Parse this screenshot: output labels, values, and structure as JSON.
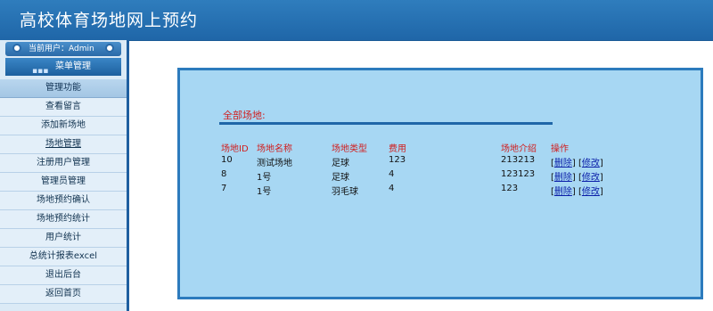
{
  "header": {
    "title": "高校体育场地网上预约"
  },
  "sidebar": {
    "user_label": "当前用户：Admin",
    "menu_title": "菜单管理",
    "section_title": "管理功能",
    "items": [
      {
        "label": "查看留言"
      },
      {
        "label": "添加新场地"
      },
      {
        "label": "场地管理"
      },
      {
        "label": "注册用户管理"
      },
      {
        "label": "管理员管理"
      },
      {
        "label": "场地预约确认"
      },
      {
        "label": "场地预约统计"
      },
      {
        "label": "用户统计"
      },
      {
        "label": "总统计报表excel"
      },
      {
        "label": "退出后台"
      },
      {
        "label": "返回首页"
      }
    ]
  },
  "main": {
    "caption": "全部场地:",
    "columns": {
      "id": "场地ID",
      "name": "场地名称",
      "type": "场地类型",
      "fee": "费用",
      "intro": "场地介绍",
      "action": "操作"
    },
    "rows": [
      {
        "id": "10",
        "name": "测试场地",
        "type": "足球",
        "fee": "123",
        "intro": "213213",
        "delete": "删除",
        "edit": "修改"
      },
      {
        "id": "8",
        "name": "1号",
        "type": "足球",
        "fee": "4",
        "intro": "123123",
        "delete": "删除",
        "edit": "修改"
      },
      {
        "id": "7",
        "name": "1号",
        "type": "羽毛球",
        "fee": "4",
        "intro": "123",
        "delete": "删除",
        "edit": "修改"
      }
    ]
  }
}
